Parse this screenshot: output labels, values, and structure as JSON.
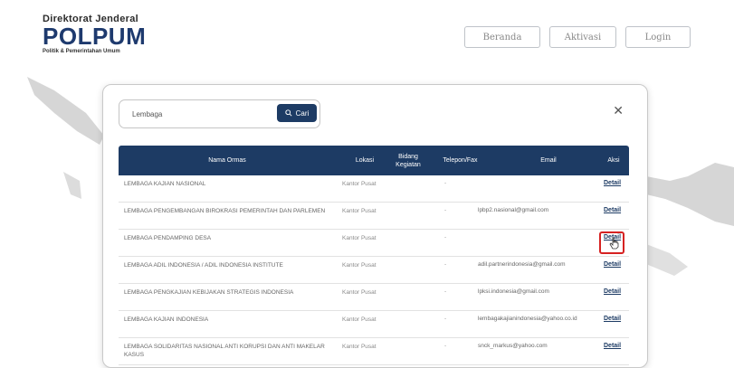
{
  "header": {
    "logo_top": "Direktorat Jenderal",
    "logo_main": "POLPUM",
    "logo_sub": "Politik & Pemerintahan Umum",
    "nav": [
      "Beranda",
      "Aktivasi",
      "Login"
    ]
  },
  "search": {
    "value": "Lembaga",
    "button_label": "Cari"
  },
  "table": {
    "headers": [
      "Nama Ormas",
      "Lokasi",
      "Bidang Kegiatan",
      "Telepon/Fax",
      "Email",
      "Aksi"
    ],
    "rows": [
      {
        "name": "LEMBAGA KAJIAN NASIONAL",
        "lokasi": "Kantor Pusat",
        "telepon": "-",
        "email": "",
        "aksi": "Detail"
      },
      {
        "name": "LEMBAGA PENGEMBANGAN BIROKRASI PEMERINTAH DAN PARLEMEN",
        "lokasi": "Kantor Pusat",
        "telepon": "-",
        "email": "lpbp2.nasional@gmail.com",
        "aksi": "Detail"
      },
      {
        "name": "LEMBAGA PENDAMPING DESA",
        "lokasi": "Kantor Pusat",
        "telepon": "-",
        "email": "",
        "aksi": "Detail"
      },
      {
        "name": "LEMBAGA ADIL INDONESIA / ADIL INDONESIA INSTITUTE",
        "lokasi": "Kantor Pusat",
        "telepon": "-",
        "email": "adil.partnerindonesia@gmail.com",
        "aksi": "Detail"
      },
      {
        "name": "LEMBAGA PENGKAJIAN KEBIJAKAN STRATEGIS INDONESIA",
        "lokasi": "Kantor Pusat",
        "telepon": "-",
        "email": "lpksi.indonesia@gmail.com",
        "aksi": "Detail"
      },
      {
        "name": "LEMBAGA KAJIAN INDONESIA",
        "lokasi": "Kantor Pusat",
        "telepon": "-",
        "email": "lembagakajianindonesia@yahoo.co.id",
        "aksi": "Detail"
      },
      {
        "name": "LEMBAGA SOLIDARITAS NASIONAL ANTI KORUPSI DAN ANTI MAKELAR KASUS",
        "lokasi": "Kantor Pusat",
        "telepon": "-",
        "email": "snck_markus@yahoo.com",
        "aksi": "Detail"
      }
    ]
  },
  "colors": {
    "primary": "#1d3b64",
    "highlight": "#d62222",
    "map": "#d6d6d6"
  }
}
